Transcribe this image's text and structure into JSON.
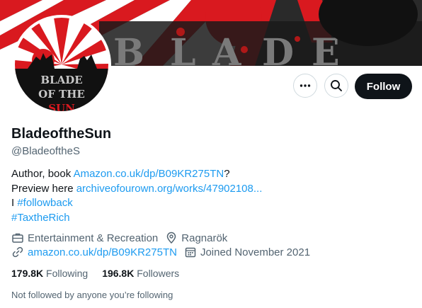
{
  "profile": {
    "name": "BladeoftheSun",
    "handle": "@BladeoftheS",
    "avatar_text_line1": "BLADE",
    "avatar_text_line2": "OF THE",
    "avatar_text_line3": "SUN"
  },
  "actions": {
    "more_icon": "more-icon",
    "search_icon": "search-icon",
    "follow_label": "Follow"
  },
  "bio": {
    "line1_prefix": "Author, book ",
    "line1_link": "Amazon.co.uk/dp/B09KR275TN",
    "line1_suffix": "?",
    "line2_prefix": "Preview here ",
    "line2_link": "archiveofourown.org/works/47902108...",
    "line3_prefix": "I ",
    "line3_hashtag": "#followback",
    "line4_hashtag": "#TaxtheRich"
  },
  "meta": {
    "category": "Entertainment & Recreation",
    "location": "Ragnarök",
    "website": "amazon.co.uk/dp/B09KR275TN",
    "joined": "Joined November 2021"
  },
  "stats": {
    "following_count": "179.8K",
    "following_label": "Following",
    "followers_count": "196.8K",
    "followers_label": "Followers"
  },
  "followed_by": "Not followed by anyone you’re following",
  "colors": {
    "link": "#1d9bf0",
    "secondary_text": "#536471",
    "primary_text": "#0f1419",
    "banner_red": "#d9191f"
  }
}
